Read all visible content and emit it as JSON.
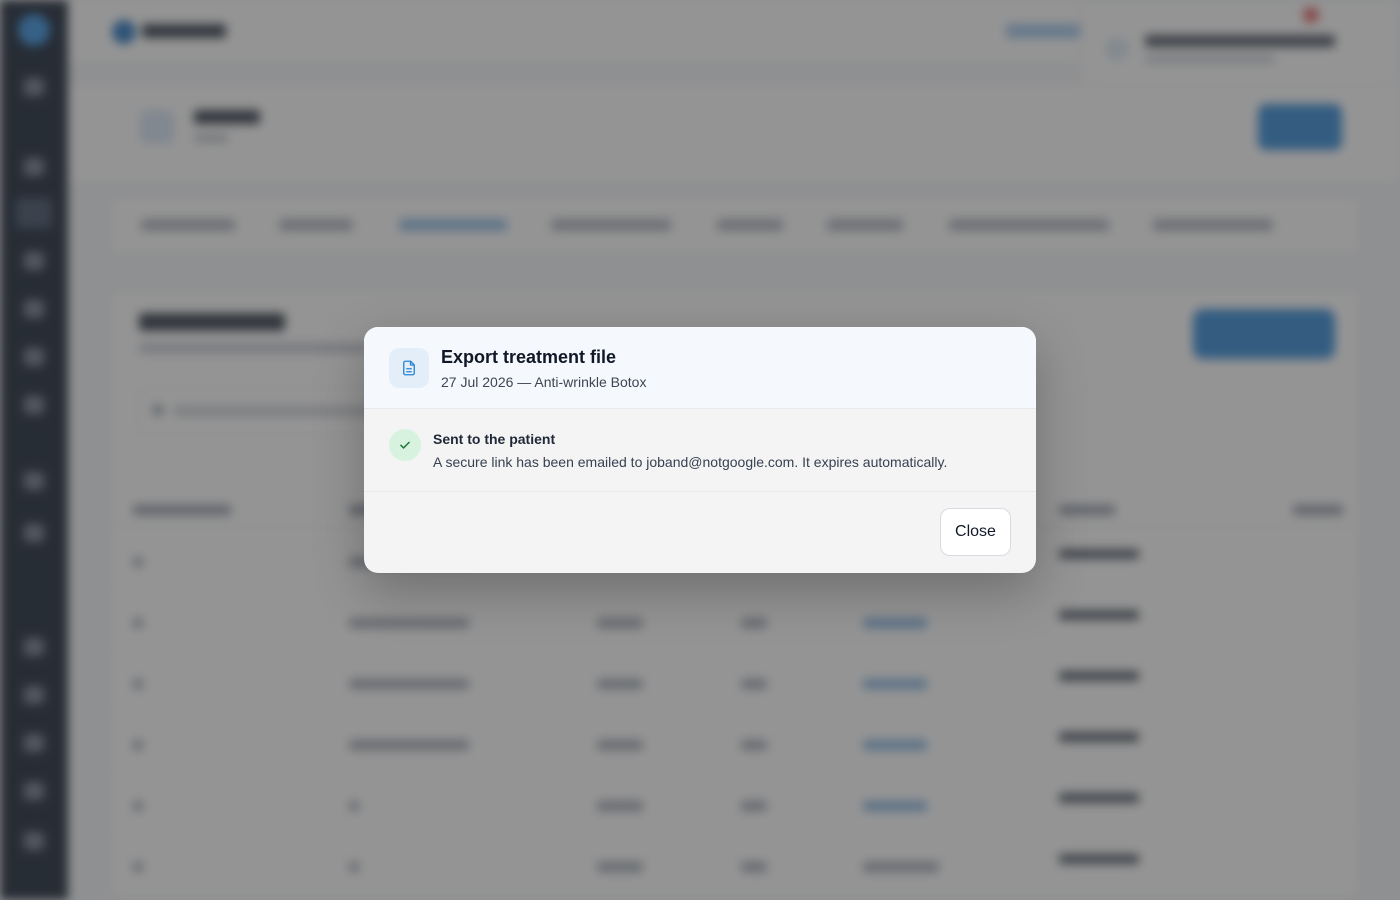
{
  "modal": {
    "title": "Export treatment file",
    "subtitle": "27 Jul 2026 — Anti-wrinkle Botox",
    "header_icon": "document-icon",
    "status": {
      "icon": "check-icon",
      "title": "Sent to the patient",
      "message": "A secure link has been emailed to joband@notgoogle.com. It expires automatically."
    },
    "close_label": "Close"
  },
  "colors": {
    "overlay": "rgba(60,60,60,0.55)",
    "accent": "#2a84d6",
    "success": "#1f7a3a",
    "success_bg": "#d7f3df"
  }
}
